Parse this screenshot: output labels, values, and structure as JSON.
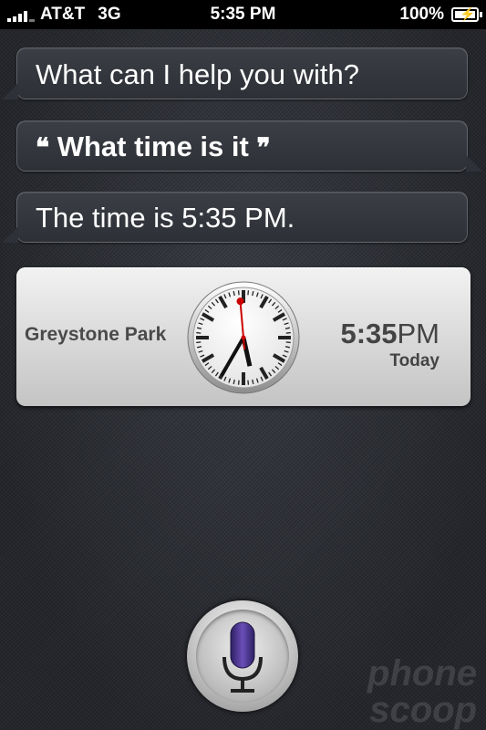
{
  "status_bar": {
    "carrier": "AT&T",
    "network": "3G",
    "time": "5:35 PM",
    "battery": "100%",
    "icons": [
      "signal-icon",
      "battery-charging-icon"
    ]
  },
  "conversation": {
    "prompt": "What can I help you with?",
    "user_query": "What time is it",
    "quote_open": "❝",
    "quote_close": "❞",
    "answer": "The time is 5:35 PM."
  },
  "clock_card": {
    "location": "Greystone Park",
    "time_digits": "5:35",
    "time_period": "PM",
    "day": "Today",
    "clock_hour": 5,
    "clock_minute": 35
  },
  "watermark": {
    "line1": "phone",
    "line2": "scoop"
  },
  "colors": {
    "second_hand": "#cc0000",
    "clock_face": "#f7f7f7",
    "mic_icon": "#5b3f9e"
  }
}
